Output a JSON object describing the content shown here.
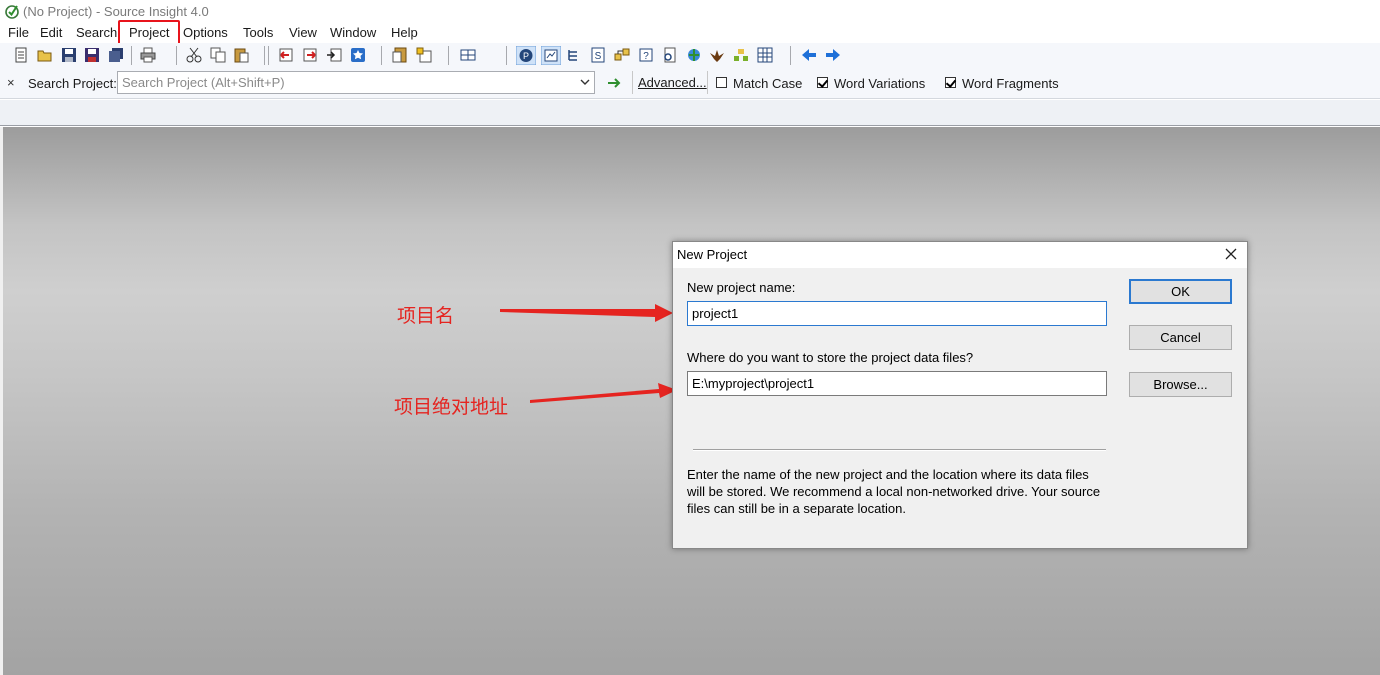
{
  "window": {
    "title": "(No Project) - Source Insight 4.0",
    "icon": "source-insight-logo-icon"
  },
  "menubar": {
    "items": [
      {
        "label": "File"
      },
      {
        "label": "Edit"
      },
      {
        "label": "Search"
      },
      {
        "label": "Project",
        "highlighted": true
      },
      {
        "label": "Options"
      },
      {
        "label": "Tools"
      },
      {
        "label": "View"
      },
      {
        "label": "Window"
      },
      {
        "label": "Help"
      }
    ],
    "highlight_color": "#e8141c"
  },
  "search_bar": {
    "close_glyph": "×",
    "label": "Search Project:",
    "placeholder": "Search Project (Alt+Shift+P)",
    "value": "",
    "advanced_label": "Advanced...",
    "options": [
      {
        "label": "Match Case",
        "checked": false
      },
      {
        "label": "Word Variations",
        "checked": true
      },
      {
        "label": "Word Fragments",
        "checked": true
      }
    ]
  },
  "annotations": [
    {
      "text": "项目名",
      "color": "#e52420"
    },
    {
      "text": "项目绝对地址",
      "color": "#e52420"
    }
  ],
  "dialog": {
    "title": "New Project",
    "name_label": "New project name:",
    "name_value": "project1",
    "location_label": "Where do you want to store the project data files?",
    "location_value": "E:\\myproject\\project1",
    "ok_label": "OK",
    "cancel_label": "Cancel",
    "browse_label": "Browse...",
    "help_text": "Enter the name of the new project and the location where its data files will be stored. We recommend a local non-networked drive. Your source files can still be in a separate location.",
    "accent_color": "#2b79d0"
  }
}
